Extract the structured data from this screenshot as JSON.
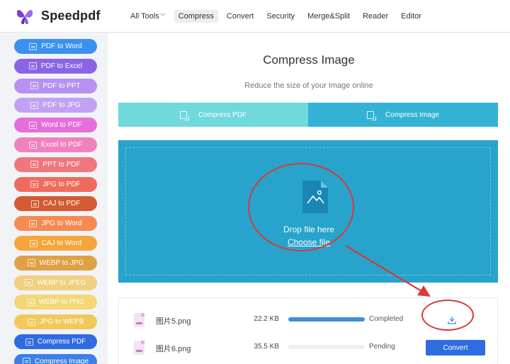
{
  "header": {
    "brand": "Speedpdf",
    "nav": [
      {
        "label": "All Tools",
        "dropdown": true,
        "active": false
      },
      {
        "label": "Compress",
        "active": true
      },
      {
        "label": "Convert",
        "active": false
      },
      {
        "label": "Security",
        "active": false
      },
      {
        "label": "Merge&Split",
        "active": false
      },
      {
        "label": "Reader",
        "active": false
      },
      {
        "label": "Editor",
        "active": false
      }
    ]
  },
  "sidebar": {
    "items": [
      {
        "label": "PDF to Word",
        "color": "#3a91f0"
      },
      {
        "label": "PDF to Excel",
        "color": "#8b64e6"
      },
      {
        "label": "PDF to PPT",
        "color": "#b892f2"
      },
      {
        "label": "PDF to JPG",
        "color": "#c1a1f3"
      },
      {
        "label": "Word to PDF",
        "color": "#e46fd8"
      },
      {
        "label": "Excel to PDF",
        "color": "#f081bf"
      },
      {
        "label": "PPT to PDF",
        "color": "#f0767e"
      },
      {
        "label": "JPG to PDF",
        "color": "#ee6c5f"
      },
      {
        "label": "CAJ to PDF",
        "color": "#d45a33"
      },
      {
        "label": "JPG to Word",
        "color": "#f58a52"
      },
      {
        "label": "CAJ to Word",
        "color": "#f6a53c"
      },
      {
        "label": "WEBP to JPG",
        "color": "#e0a045"
      },
      {
        "label": "WEBP to JPEG",
        "color": "#f0cf7e"
      },
      {
        "label": "WEBP to PNG",
        "color": "#f2d774"
      },
      {
        "label": "JPG to WEPB",
        "color": "#f0c95a"
      },
      {
        "label": "Compress PDF",
        "color": "#2f6ce0"
      },
      {
        "label": "Compress Image",
        "color": "#3a80e6"
      }
    ]
  },
  "main": {
    "title": "Compress Image",
    "subtitle": "Reduce the size of your Image online",
    "tabs": [
      {
        "label": "Compress PDF",
        "active": false
      },
      {
        "label": "Compress Image",
        "active": true
      }
    ],
    "dropzone": {
      "drop_text": "Drop file here",
      "choose_text": "Choose file"
    },
    "files": [
      {
        "name": "图片5.png",
        "size": "22.2 KB",
        "progress": 100,
        "status": "Completed",
        "action": "download"
      },
      {
        "name": "图片6.png",
        "size": "35.5 KB",
        "progress": 0,
        "status": "Pending",
        "action": "Convert"
      }
    ]
  },
  "colors": {
    "accent": "#27a3cc",
    "tab_inactive": "#6fd9dc",
    "tab_active": "#34b2d6",
    "annotation": "#d93a3a",
    "convert": "#2f6ce0"
  }
}
